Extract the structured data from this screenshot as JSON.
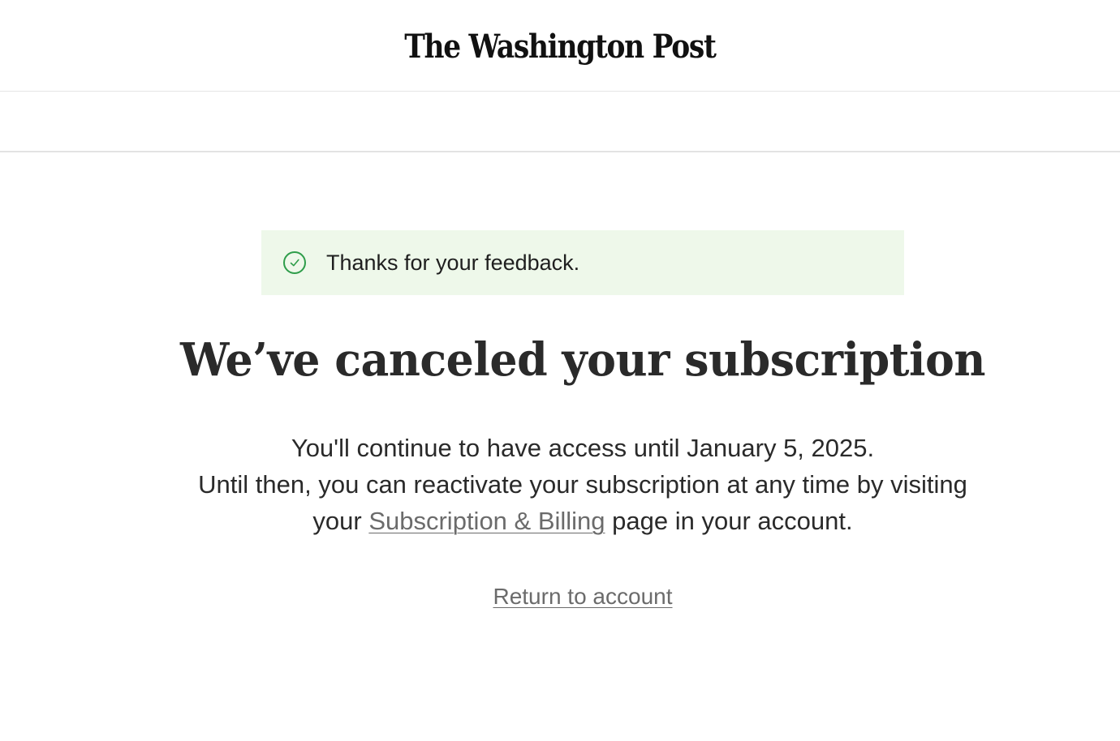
{
  "header": {
    "logo_text": "The Washington Post"
  },
  "banner": {
    "icon": "check-circle-icon",
    "message": "Thanks for your feedback.",
    "background": "#eef8ea",
    "icon_color": "#2e9d4a"
  },
  "main": {
    "title": "We’ve canceled your subscription",
    "line1": "You'll continue to have access until January 5, 2025.",
    "line2": "Until then, you can reactivate your subscription at any time by visiting",
    "line3_prefix": "your ",
    "billing_link": "Subscription & Billing",
    "line3_suffix": " page in your account.",
    "return_link": "Return to account"
  }
}
